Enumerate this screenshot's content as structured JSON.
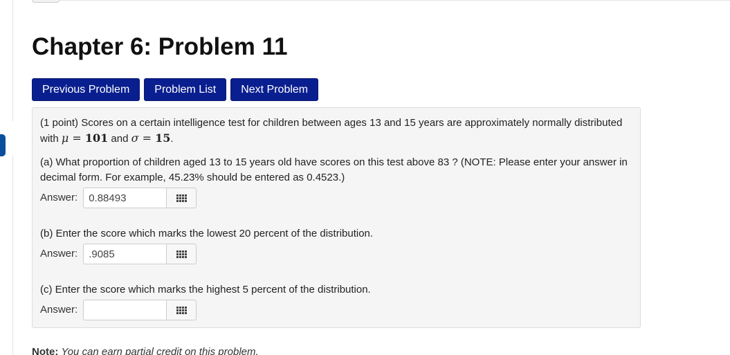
{
  "page": {
    "title": "Chapter 6: Problem 11"
  },
  "nav": {
    "previous_label": "Previous Problem",
    "list_label": "Problem List",
    "next_label": "Next Problem"
  },
  "problem": {
    "intro_prefix": "(1 point) Scores on a certain intelligence test for children between ages 13 and 15 years are approximately normally distributed with ",
    "mu_symbol": "μ",
    "equals": " = ",
    "mu_value": "101",
    "and_text": " and ",
    "sigma_symbol": "σ",
    "sigma_value": "15",
    "intro_suffix": ".",
    "part_a": "(a) What proportion of children aged 13 to 15 years old have scores on this test above 83 ? (NOTE: Please enter your answer in decimal form. For example, 45.23% should be entered as 0.4523.)",
    "part_b": "(b) Enter the score which marks the lowest 20 percent of the distribution.",
    "part_c": "(c) Enter the score which marks the highest 5 percent of the distribution.",
    "answer_label": "Answer:",
    "answers": {
      "a": "0.88493",
      "b": ".9085",
      "c": ""
    },
    "equation_editor_icon": "grid-icon"
  },
  "note": {
    "label": "Note:",
    "text": "You can earn partial credit on this problem."
  },
  "colors": {
    "nav_button_bg": "#0a1f8f",
    "problem_bg": "#f5f5f5",
    "side_tab": "#0a4f9e"
  }
}
